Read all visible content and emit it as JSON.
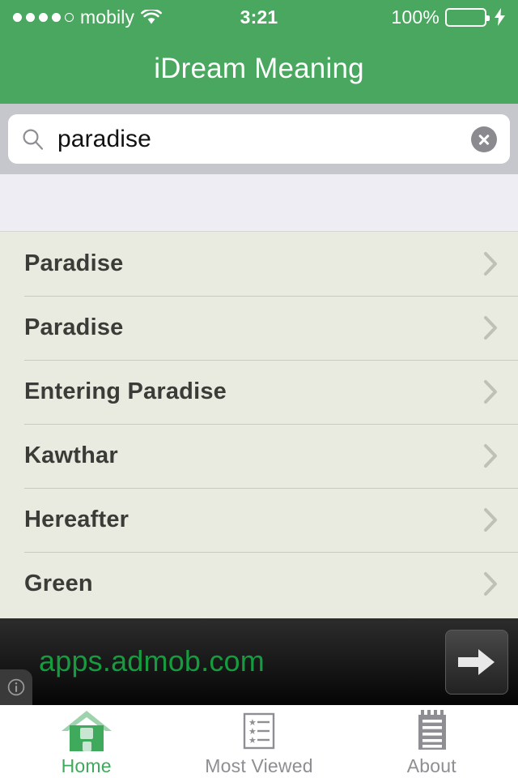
{
  "status_bar": {
    "signal_dots_total": 5,
    "signal_dots_filled": 4,
    "carrier": "mobily",
    "wifi_icon": "wifi-icon",
    "time": "3:21",
    "battery_percent": "100%",
    "battery_level": 100,
    "charging": true,
    "charging_icon": "lightning-bolt-icon"
  },
  "header": {
    "title": "iDream Meaning",
    "background_color": "#4aa75f"
  },
  "search": {
    "value": "paradise",
    "placeholder": "Search",
    "search_icon": "search-icon",
    "clear_icon": "clear-circle-icon"
  },
  "results": {
    "background_color": "#eaebe0",
    "accessory_icon": "chevron-right-icon",
    "items": [
      {
        "label": "Paradise"
      },
      {
        "label": "Paradise"
      },
      {
        "label": "Entering Paradise"
      },
      {
        "label": "Kawthar"
      },
      {
        "label": "Hereafter"
      },
      {
        "label": "Green"
      }
    ]
  },
  "ad": {
    "url": "apps.admob.com",
    "url_color": "#169b3f",
    "info_icon": "info-circle-icon",
    "action_icon": "arrow-right-icon"
  },
  "tab_bar": {
    "active_color": "#3faa5b",
    "inactive_color": "#8e8e93",
    "tabs": [
      {
        "label": "Home",
        "icon": "house-icon",
        "active": true
      },
      {
        "label": "Most Viewed",
        "icon": "starred-list-icon",
        "active": false
      },
      {
        "label": "About",
        "icon": "notepad-icon",
        "active": false
      }
    ]
  }
}
